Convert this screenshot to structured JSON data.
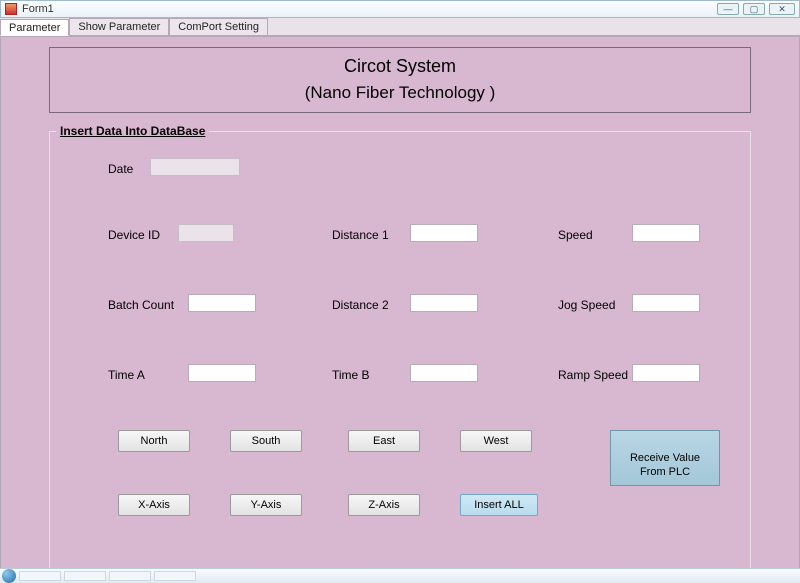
{
  "window": {
    "title": "Form1"
  },
  "tabs": [
    {
      "label": "Parameter",
      "active": true
    },
    {
      "label": "Show Parameter",
      "active": false
    },
    {
      "label": "ComPort Setting",
      "active": false
    }
  ],
  "header": {
    "title1": "Circot System",
    "title2": "(Nano Fiber Technology )"
  },
  "group": {
    "legend": "Insert Data Into DataBase",
    "fields": {
      "date": {
        "label": "Date",
        "value": ""
      },
      "device_id": {
        "label": "Device ID",
        "value": ""
      },
      "batch_count": {
        "label": "Batch Count",
        "value": ""
      },
      "time_a": {
        "label": "Time A",
        "value": ""
      },
      "distance_1": {
        "label": "Distance 1",
        "value": ""
      },
      "distance_2": {
        "label": "Distance 2",
        "value": ""
      },
      "time_b": {
        "label": "Time B",
        "value": ""
      },
      "speed": {
        "label": "Speed",
        "value": ""
      },
      "jog_speed": {
        "label": "Jog Speed",
        "value": ""
      },
      "ramp_speed": {
        "label": "Ramp Speed",
        "value": ""
      }
    },
    "buttons": {
      "north": "North",
      "south": "South",
      "east": "East",
      "west": "West",
      "x_axis": "X-Axis",
      "y_axis": "Y-Axis",
      "z_axis": "Z-Axis",
      "insert_all": "Insert ALL",
      "receive_plc": "Receive Value\nFrom PLC"
    }
  }
}
